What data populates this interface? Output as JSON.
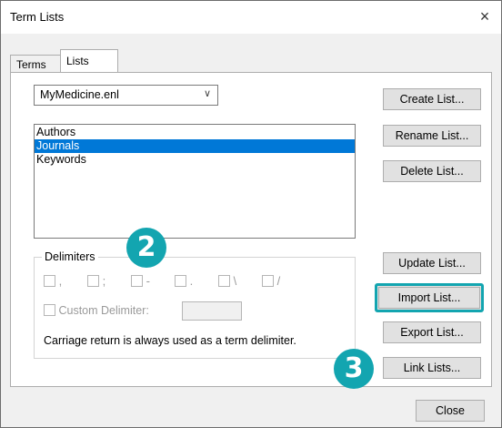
{
  "window": {
    "title": "Term Lists",
    "close_glyph": "×"
  },
  "tabs": [
    {
      "label": "Terms"
    },
    {
      "label": "Lists"
    }
  ],
  "combo": {
    "value": "MyMedicine.enl",
    "chevron": "∨"
  },
  "lists": [
    {
      "label": "Authors"
    },
    {
      "label": "Journals",
      "selected": true
    },
    {
      "label": "Keywords"
    }
  ],
  "delimiters": {
    "group_label": "Delimiters",
    "options": [
      ",",
      ";",
      "-",
      ".",
      "\\",
      "/"
    ],
    "custom_label": "Custom Delimiter:",
    "note": "Carriage return is always used as a term delimiter."
  },
  "buttons": {
    "create": "Create List...",
    "rename": "Rename List...",
    "delete": "Delete List...",
    "update": "Update List...",
    "import": "Import List...",
    "export": "Export List...",
    "link": "Link Lists...",
    "close": "Close"
  },
  "badges": {
    "b2": "2",
    "b3": "3"
  },
  "colors": {
    "selection": "#0078d7",
    "annotation": "#13a5b0"
  }
}
